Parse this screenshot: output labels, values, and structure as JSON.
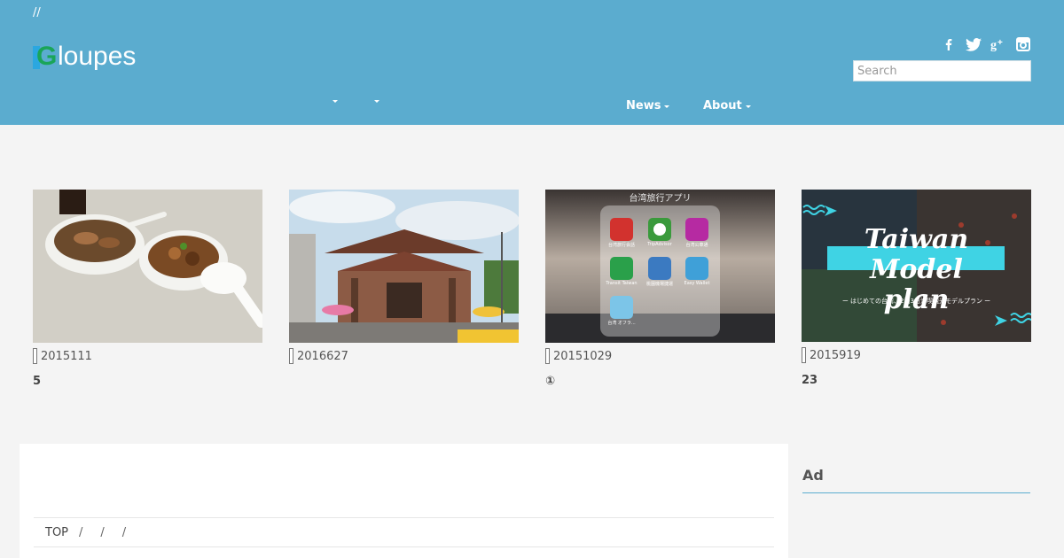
{
  "header": {
    "top_text": "//",
    "logo_letter": "G",
    "logo_text": "loupes",
    "search_placeholder": "Search",
    "social": [
      {
        "icon": "facebook-icon",
        "glyph": "f"
      },
      {
        "icon": "twitter-icon",
        "glyph": "🐦"
      },
      {
        "icon": "google-plus-icon",
        "glyph": "g+"
      },
      {
        "icon": "instagram-icon",
        "glyph": "◙"
      }
    ],
    "nav": [
      {
        "label": ""
      },
      {
        "label": ""
      },
      {
        "label": "News"
      },
      {
        "label": "About"
      }
    ],
    "accent": "#5baccf"
  },
  "cards": [
    {
      "date": "2015111",
      "title": "5",
      "image": "food-photo"
    },
    {
      "date": "2016627",
      "title": "",
      "image": "temple-photo"
    },
    {
      "date": "20151029",
      "title": "①",
      "image": "apps-photo",
      "image_text": "台湾旅行アプリ",
      "app_labels": [
        "台湾旅行会話",
        "TripAdvisor",
        "台湾公車通",
        "Transit Taiwan",
        "桃園機場捷運",
        "Easy Wallet",
        "台湾 オフラ..."
      ]
    },
    {
      "date": "2015919",
      "title": "23",
      "image": "taiwan-model-plan",
      "image_text": "Taiwan Model plan",
      "image_subtext": "ー はじめての台湾、2泊3日満喫観光モデルプラン ー"
    }
  ],
  "main": {
    "breadcrumb": {
      "top": "TOP",
      "seps": [
        "/",
        "/",
        "/"
      ]
    }
  },
  "sidebar": {
    "ad_title": "Ad"
  }
}
